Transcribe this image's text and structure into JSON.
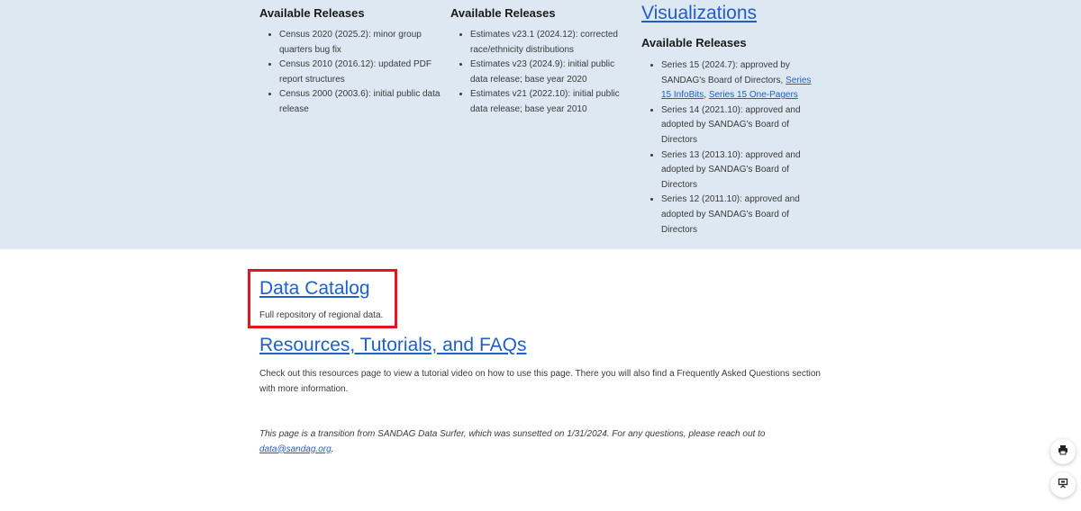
{
  "columns": [
    {
      "heading": "Available Releases",
      "items": [
        "Census 2020 (2025.2): minor group quarters bug fix",
        "Census 2010 (2016.12): updated PDF report structures",
        "Census 2000 (2003.6): initial public data release"
      ]
    },
    {
      "heading": "Available Releases",
      "items": [
        "Estimates v23.1 (2024.12): corrected race/ethnicity distributions",
        "Estimates v23 (2024.9): initial public data release; base year 2020",
        "Estimates v21 (2022.10): initial public data release; base year 2010"
      ]
    },
    {
      "title": "Visualizations",
      "heading": "Available Releases",
      "item0_text": "Series 15 (2024.7): approved by SANDAG's Board of Directors,",
      "item0_link1": "Series 15 InfoBits",
      "item0_sep": ",",
      "item0_link2": "Series 15 One-Pagers",
      "items": [
        "Series 14 (2021.10): approved and adopted by SANDAG's Board of Directors",
        "Series 13 (2013.10): approved and adopted by SANDAG's Board of Directors",
        "Series 12 (2011.10): approved and adopted by SANDAG's Board of Directors"
      ]
    }
  ],
  "data_catalog": {
    "title": "Data Catalog",
    "description": "Full repository of regional data."
  },
  "resources": {
    "title": "Resources, Tutorials, and FAQs",
    "description": "Check out this resources page to view a tutorial video on how to use this page. There you will also find a Frequently Asked Questions section with more information."
  },
  "note": {
    "text": "This page is a transition from SANDAG Data Surfer, which was sunsetted on 1/31/2024. For any questions, please reach out to",
    "email": "data@sandag.org",
    "end": "."
  },
  "fabs": [
    {
      "icon": "print-icon"
    },
    {
      "icon": "presentation-icon"
    }
  ],
  "colors": {
    "band_bg": "#dde8f2",
    "link": "#1f5fc9",
    "highlight_border": "#e8141b"
  }
}
